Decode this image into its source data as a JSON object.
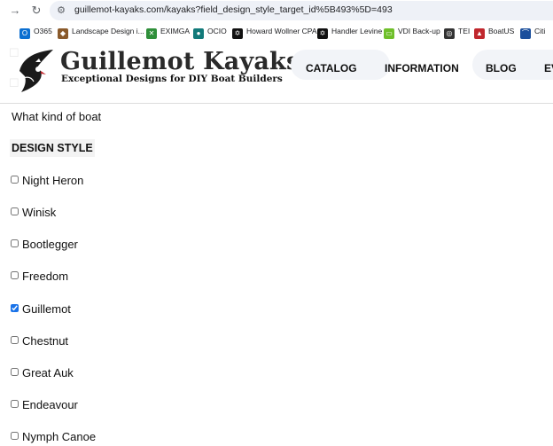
{
  "browser": {
    "url": "guillemot-kayaks.com/kayaks?field_design_style_target_id%5B493%5D=493",
    "bookmarks": [
      {
        "label": "O365",
        "color": "#0b6fd1"
      },
      {
        "label": "Landscape Design i...",
        "color": "#8a5a2b"
      },
      {
        "label": "EXIMGA",
        "color": "#2f8f3a"
      },
      {
        "label": "OCIO",
        "color": "#127a7a"
      },
      {
        "label": "Howard Wollner CPA",
        "color": "#111111"
      },
      {
        "label": "Handler Levine",
        "color": "#111111"
      },
      {
        "label": "VDI Back-up",
        "color": "#6fbf2a"
      },
      {
        "label": "TEI",
        "color": "#333333"
      },
      {
        "label": "BoatUS",
        "color": "#c0272d"
      },
      {
        "label": "Citi",
        "color": "#1b4f9c"
      }
    ]
  },
  "header": {
    "title": "Guillemot Kayaks",
    "subtitle": "Exceptional Designs for DIY Boat Builders",
    "nav": [
      "CATALOG",
      "INFORMATION",
      "BLOG",
      "EV"
    ]
  },
  "filter": {
    "question": "What kind of boat",
    "title": "DESIGN STYLE",
    "options": [
      {
        "label": "Night Heron",
        "checked": false
      },
      {
        "label": "Winisk",
        "checked": false
      },
      {
        "label": "Bootlegger",
        "checked": false
      },
      {
        "label": "Freedom",
        "checked": false
      },
      {
        "label": "Guillemot",
        "checked": true
      },
      {
        "label": "Chestnut",
        "checked": false
      },
      {
        "label": "Great Auk",
        "checked": false
      },
      {
        "label": "Endeavour",
        "checked": false
      },
      {
        "label": "Nymph Canoe",
        "checked": false
      }
    ]
  },
  "icons": {
    "forward": "arrow-right-icon",
    "reload": "reload-icon",
    "site_info": "site-info-icon"
  }
}
